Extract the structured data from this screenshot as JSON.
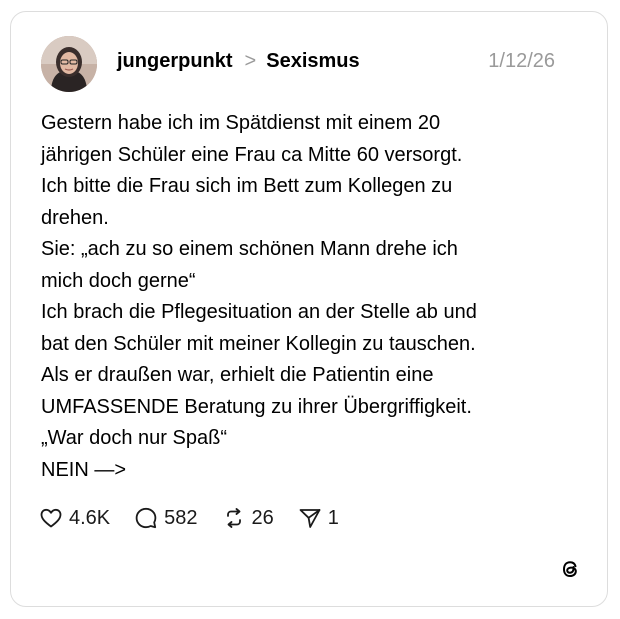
{
  "post": {
    "username": "jungerpunkt",
    "separator": ">",
    "topic": "Sexismus",
    "date": "1/12/26",
    "lines": [
      "Gestern habe ich im Spätdienst mit einem 20",
      "jährigen Schüler eine Frau ca Mitte 60 versorgt.",
      "Ich bitte die Frau sich im Bett zum Kollegen zu",
      "drehen.",
      "Sie: „ach zu so einem schönen Mann drehe ich",
      "mich doch gerne“",
      "Ich brach die Pflegesituation an der Stelle ab und",
      "bat den Schüler mit meiner Kollegin zu tauschen.",
      "Als er draußen war, erhielt die Patientin eine",
      "UMFASSENDE Beratung zu ihrer Übergriffigkeit.",
      "„War doch nur Spaß“",
      "NEIN —>"
    ]
  },
  "actions": {
    "likes": "4.6K",
    "replies": "582",
    "reposts": "26",
    "shares": "1"
  },
  "icons": {
    "like": "heart-icon",
    "reply": "comment-icon",
    "repost": "repost-icon",
    "share": "send-icon",
    "brand": "threads-logo-icon"
  },
  "colors": {
    "text": "#000000",
    "muted": "#9a9a9a",
    "border": "#dddddd"
  }
}
